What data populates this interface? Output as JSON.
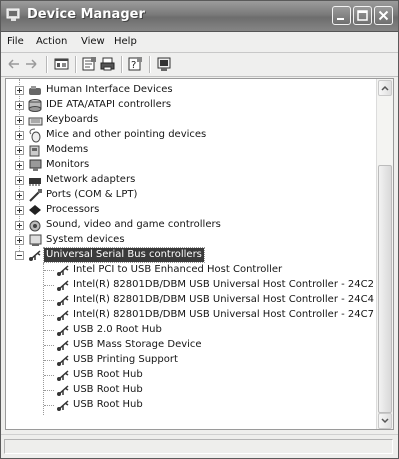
{
  "window": {
    "title": "Device Manager"
  },
  "menu": {
    "items": [
      "File",
      "Action",
      "View",
      "Help"
    ]
  },
  "tree": {
    "categories": [
      {
        "label": "Human Interface Devices",
        "icon": "hid-icon"
      },
      {
        "label": "IDE ATA/ATAPI controllers",
        "icon": "ide-controller-icon"
      },
      {
        "label": "Keyboards",
        "icon": "keyboard-icon"
      },
      {
        "label": "Mice and other pointing devices",
        "icon": "mouse-icon"
      },
      {
        "label": "Modems",
        "icon": "modem-icon"
      },
      {
        "label": "Monitors",
        "icon": "monitor-icon"
      },
      {
        "label": "Network adapters",
        "icon": "network-adapter-icon"
      },
      {
        "label": "Ports (COM & LPT)",
        "icon": "port-icon"
      },
      {
        "label": "Processors",
        "icon": "processor-icon"
      },
      {
        "label": "Sound, video and game controllers",
        "icon": "sound-icon"
      },
      {
        "label": "System devices",
        "icon": "system-device-icon"
      }
    ],
    "usb": {
      "label": "Universal Serial Bus controllers",
      "children": [
        "Intel PCI to USB Enhanced Host Controller",
        "Intel(R) 82801DB/DBM USB Universal Host Controller - 24C2",
        "Intel(R) 82801DB/DBM USB Universal Host Controller - 24C4",
        "Intel(R) 82801DB/DBM USB Universal Host Controller - 24C7",
        "USB 2.0 Root Hub",
        "USB Mass Storage Device",
        "USB Printing Support",
        "USB Root Hub",
        "USB Root Hub",
        "USB Root Hub"
      ]
    }
  }
}
